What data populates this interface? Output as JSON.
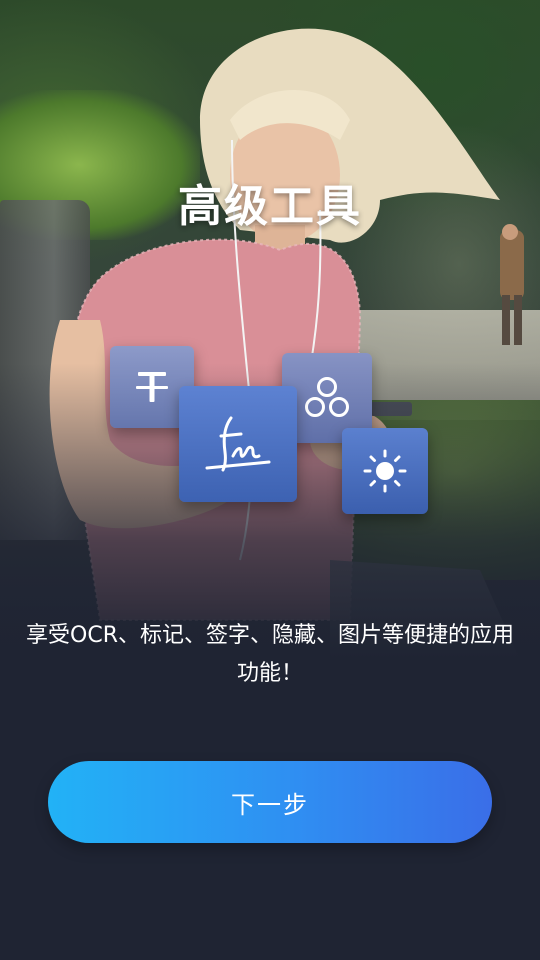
{
  "screen": {
    "title": "高级工具",
    "description": "享受OCR、标记、签字、隐藏、图片等便捷的应用功能！",
    "next_button_label": "下一步"
  },
  "feature_icons": [
    "text-strikethrough-icon",
    "signature-icon",
    "circles-icon",
    "brightness-icon"
  ],
  "colors": {
    "background": "#1f2433",
    "button_gradient_start": "#22b2f6",
    "button_gradient_end": "#3a6ee8",
    "tile_blue": "#4a6fc0",
    "tile_gray_blue": "#7482b8"
  }
}
